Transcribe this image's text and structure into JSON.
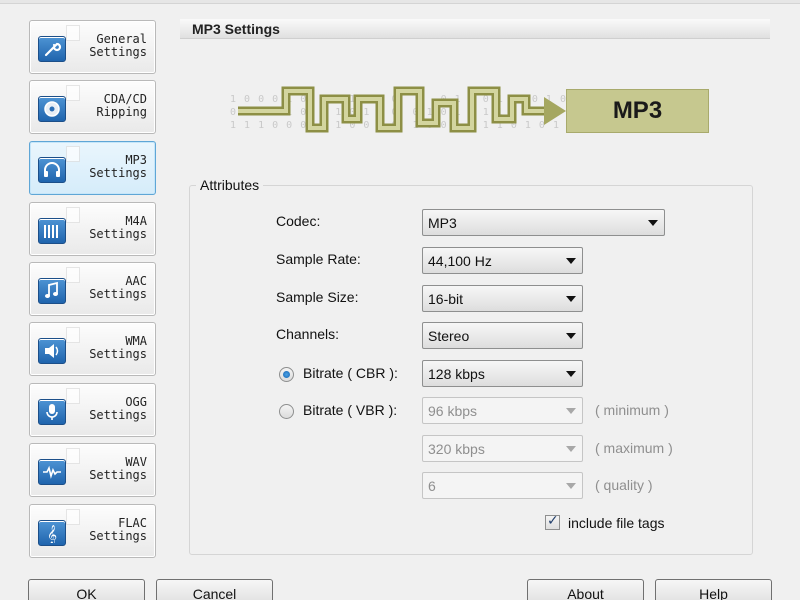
{
  "sidebar": {
    "items": [
      {
        "label": "General\nSettings",
        "icon": "wrench-icon"
      },
      {
        "label": "CDA/CD\nRipping",
        "icon": "disc-icon"
      },
      {
        "label": "MP3\nSettings",
        "icon": "headphones-icon",
        "active": true
      },
      {
        "label": "M4A\nSettings",
        "icon": "equalizer-icon"
      },
      {
        "label": "AAC\nSettings",
        "icon": "music-note-icon"
      },
      {
        "label": "WMA\nSettings",
        "icon": "speaker-icon"
      },
      {
        "label": "OGG\nSettings",
        "icon": "microphone-icon"
      },
      {
        "label": "WAV\nSettings",
        "icon": "waveform-icon"
      },
      {
        "label": "FLAC\nSettings",
        "icon": "treble-clef-icon"
      }
    ]
  },
  "header": {
    "title": "MP3 Settings"
  },
  "banner": {
    "bits": "1 0 0 0 1 0  0 1 1 0 1 0      0 1 1 0 1 1  0 1 0\n0 1 0 1 1 0  0 1 0 1 1 0  0 1 0 1 0 1 1 0 1 0 0 1 1\n1 1 1 0 0 0  0 1 0 0 1 0  1 0 0 1 0 1 1 0 1 0 1 0 0",
    "label": "MP3"
  },
  "attributes": {
    "title": "Attributes",
    "codec": {
      "label": "Codec:",
      "value": "MP3"
    },
    "sample_rate": {
      "label": "Sample Rate:",
      "value": "44,100 Hz"
    },
    "sample_size": {
      "label": "Sample Size:",
      "value": "16-bit"
    },
    "channels": {
      "label": "Channels:",
      "value": "Stereo"
    },
    "cbr": {
      "label": "Bitrate ( CBR ):",
      "value": "128 kbps",
      "selected": true
    },
    "vbr": {
      "label": "Bitrate ( VBR ):",
      "min_value": "96 kbps",
      "min_hint": "( minimum )",
      "max_value": "320 kbps",
      "max_hint": "( maximum )",
      "quality_value": "6",
      "quality_hint": "( quality )",
      "selected": false
    },
    "include_tags": {
      "label": "include file tags",
      "checked": true
    }
  },
  "buttons": {
    "ok": "OK",
    "cancel": "Cancel",
    "about": "About",
    "help": "Help"
  }
}
